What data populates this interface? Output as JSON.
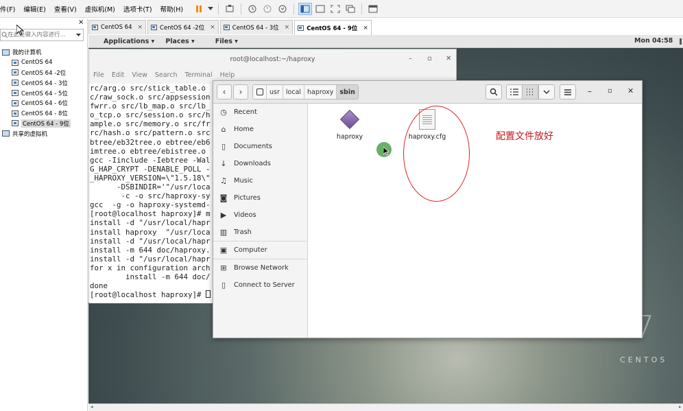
{
  "vmware": {
    "menus": [
      "件(F)",
      "编辑(E)",
      "查看(V)",
      "虚拟机(M)",
      "选项卡(T)",
      "帮助(H)"
    ],
    "library": {
      "search_placeholder": "在此处键入内容进行...",
      "close_label": "×",
      "root_label": "我的计算机",
      "vms": [
        "CentOS 64",
        "CentOS 64 -2位",
        "CentOS 64 - 3位",
        "CentOS 64 - 5位",
        "CentOS 64 - 6位",
        "CentOS 64 - 8位",
        "CentOS 64 - 9位"
      ],
      "selected_vm": "CentOS 64 - 9位",
      "shared_label": "共享的虚拟机"
    },
    "tabs": [
      {
        "label": "CentOS 64",
        "active": false
      },
      {
        "label": "CentOS 64 -2位",
        "active": false
      },
      {
        "label": "CentOS 64 - 3位",
        "active": false
      },
      {
        "label": "CentOS 64 - 9位",
        "active": true
      }
    ],
    "tab_close": "×"
  },
  "gnome": {
    "applications": "Applications ▾",
    "places": "Places ▾",
    "files": "Files ▾",
    "clock": "Mon 04:58",
    "brand_number": "7",
    "brand_word": "CENTOS"
  },
  "terminal": {
    "title": "root@localhost:~/haproxy",
    "menu": [
      "File",
      "Edit",
      "View",
      "Search",
      "Terminal",
      "Help"
    ],
    "lines": [
      "rc/arg.o src/stick_table.o",
      "c/raw_sock.o src/appsession",
      "fwrr.o src/lb_map.o src/lb_",
      "o_tcp.o src/session.o src/h",
      "ample.o src/memory.o src/fr",
      "rc/hash.o src/pattern.o src",
      "btree/eb32tree.o ebtree/eb6",
      "imtree.o ebtree/ebistree.o",
      "gcc -Iinclude -Iebtree -Wal",
      "G_HAP_CRYPT -DENABLE_POLL -",
      "_HAPROXY_VERSION=\\\"1.5.18\\\"",
      "      -DSBINDIR='\"/usr/loca",
      "       -c -o src/haproxy-sy",
      "gcc  -g -o haproxy-systemd-",
      "[root@localhost haproxy]# m",
      "install -d \"/usr/local/hapr",
      "install haproxy  \"/usr/loca",
      "install -d \"/usr/local/hapr",
      "install -m 644 doc/haproxy.",
      "install -d \"/usr/local/hapr",
      "for x in configuration arch",
      "        install -m 644 doc/",
      "done"
    ],
    "prompt": "[root@localhost haproxy]# "
  },
  "files": {
    "path": [
      "usr",
      "local",
      "haproxy",
      "sbin"
    ],
    "sidebar": [
      {
        "icon": "clock-icon",
        "glyph": "◷",
        "label": "Recent"
      },
      {
        "icon": "home-icon",
        "glyph": "⌂",
        "label": "Home"
      },
      {
        "icon": "document-icon",
        "glyph": "▯",
        "label": "Documents"
      },
      {
        "icon": "download-icon",
        "glyph": "↓",
        "label": "Downloads"
      },
      {
        "icon": "music-icon",
        "glyph": "♫",
        "label": "Music"
      },
      {
        "icon": "camera-icon",
        "glyph": "◙",
        "label": "Pictures"
      },
      {
        "icon": "video-icon",
        "glyph": "▶",
        "label": "Videos"
      },
      {
        "icon": "trash-icon",
        "glyph": "▥",
        "label": "Trash"
      },
      {
        "icon": "drive-icon",
        "glyph": "▣",
        "label": "Computer"
      },
      {
        "icon": "network-icon",
        "glyph": "⊞",
        "label": "Browse Network"
      },
      {
        "icon": "server-icon",
        "glyph": "▯",
        "label": "Connect to Server"
      }
    ],
    "items": [
      {
        "name": "haproxy",
        "type": "executable"
      },
      {
        "name": "haproxy.cfg",
        "type": "text"
      }
    ]
  },
  "annotation": "配置文件放好",
  "colors": {
    "annotation": "#c8171b",
    "gnome_bar": "#e6e6e6",
    "green_marker": "#58a657"
  }
}
